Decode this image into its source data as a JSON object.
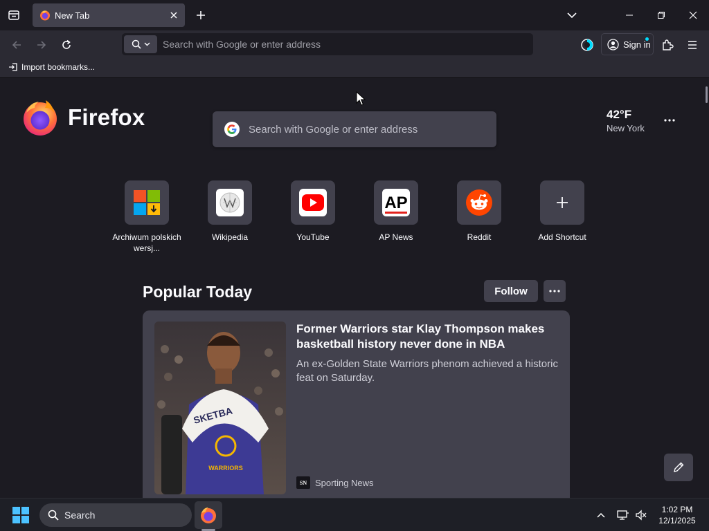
{
  "tabs": [
    {
      "title": "New Tab"
    }
  ],
  "navbar": {
    "url_placeholder": "Search with Google or enter address",
    "signin_label": "Sign in"
  },
  "bookmarks": {
    "import_label": "Import bookmarks..."
  },
  "newtab": {
    "logo_text": "Firefox",
    "search_placeholder": "Search with Google or enter address",
    "weather": {
      "temp": "42°F",
      "location": "New York"
    },
    "shortcuts": [
      {
        "label": "Archiwum polskich wersj...",
        "icon": "windows-archive-icon"
      },
      {
        "label": "Wikipedia",
        "icon": "wikipedia-icon"
      },
      {
        "label": "YouTube",
        "icon": "youtube-icon"
      },
      {
        "label": "AP News",
        "icon": "ap-news-icon"
      },
      {
        "label": "Reddit",
        "icon": "reddit-icon"
      },
      {
        "label": "Add Shortcut",
        "icon": "plus-icon"
      }
    ],
    "popular": {
      "title": "Popular Today",
      "follow_label": "Follow",
      "story": {
        "title": "Former Warriors star Klay Thompson makes basketball history never done in NBA",
        "description": "An ex-Golden State Warriors phenom achieved a historic feat on Saturday.",
        "source": "Sporting News",
        "source_logo": "SN"
      }
    }
  },
  "taskbar": {
    "search_label": "Search",
    "time": "1:02 PM",
    "date": "12/1/2025"
  },
  "colors": {
    "background": "#1c1b22",
    "toolbar": "#2b2a33",
    "card": "#42414d",
    "accent": "#00ddff"
  }
}
